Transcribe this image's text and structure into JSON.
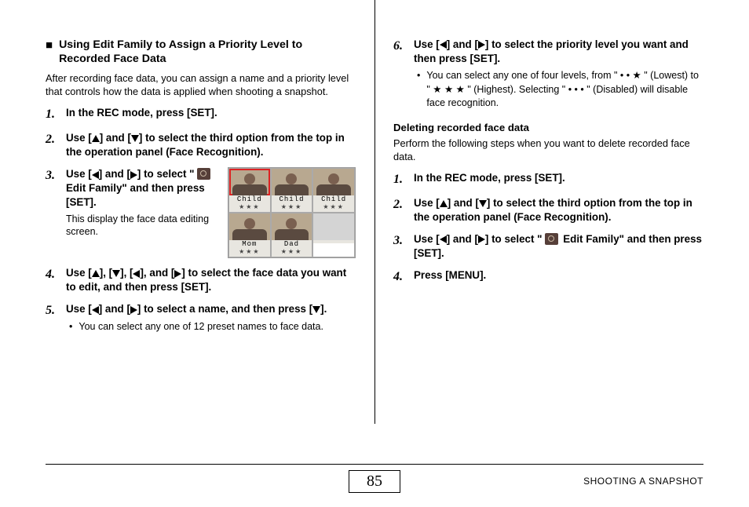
{
  "left": {
    "heading": "Using Edit Family to Assign a Priority Level to Recorded Face Data",
    "intro": "After recording face data, you can assign a name and a priority level that controls how the data is applied when shooting a snapshot.",
    "steps": {
      "s1": "In the REC mode, press [SET].",
      "s2a": "Use [",
      "s2b": "] and [",
      "s2c": "] to select the third option from the top in the operation panel (Face Recognition).",
      "s3a": "Use [",
      "s3b": "] and [",
      "s3c": "] to select \"",
      "s3d": " Edit Family\" and then press [SET].",
      "s3note": "This display the face data editing screen.",
      "s4a": "Use [",
      "s4b": "], [",
      "s4c": "], [",
      "s4d": "], and [",
      "s4e": "] to select the face data you want to edit, and then press [SET].",
      "s5a": "Use [",
      "s5b": "] and [",
      "s5c": "] to select a name, and then press [",
      "s5d": "].",
      "s5bullet": "You can select any one of 12 preset names to face data."
    },
    "faces": [
      {
        "label": "Child",
        "stars": "★★★"
      },
      {
        "label": "Child",
        "stars": "★★★"
      },
      {
        "label": "Child",
        "stars": "★★★"
      },
      {
        "label": "Mom",
        "stars": "★★★"
      },
      {
        "label": "Dad",
        "stars": "★★★"
      },
      {
        "label": "",
        "stars": ""
      }
    ]
  },
  "right": {
    "s6a": "Use [",
    "s6b": "] and [",
    "s6c": "] to select the priority level you want and then press [SET].",
    "s6bullet_a": "You can select any one of four levels, from \" • • ★ \" (Lowest) to \" ★ ★ ★ \" (Highest). Selecting \" • • • \" (Disabled) will disable face recognition.",
    "del_head": "Deleting recorded face data",
    "del_intro": "Perform the following steps when you want to delete recorded face data.",
    "d1": "In the REC mode, press [SET].",
    "d2a": "Use [",
    "d2b": "] and [",
    "d2c": "] to select the third option from the top in the operation panel (Face Recognition).",
    "d3a": "Use [",
    "d3b": "] and [",
    "d3c": "] to select \"",
    "d3d": " Edit Family\" and then press [SET].",
    "d4": "Press [MENU]."
  },
  "footer": {
    "page": "85",
    "title": "SHOOTING A SNAPSHOT"
  }
}
